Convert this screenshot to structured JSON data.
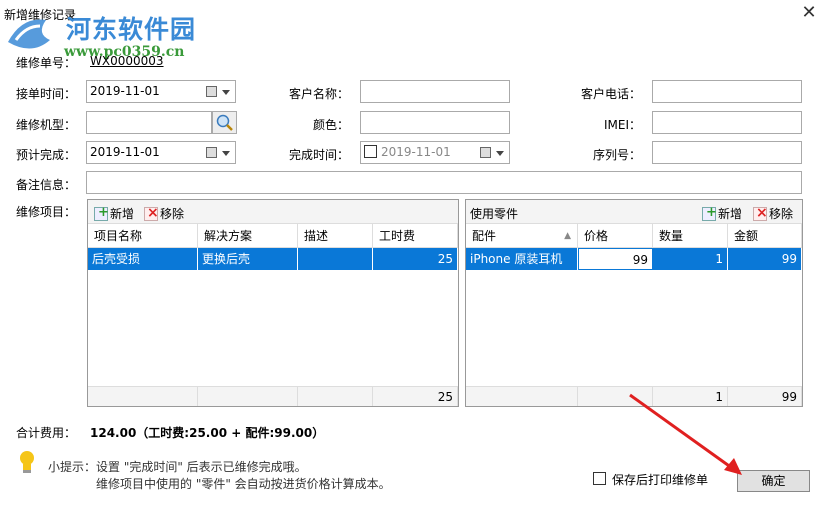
{
  "window": {
    "title": "新增维修记录"
  },
  "watermark": {
    "line1": "河东软件园",
    "line2": "www.pc0359.cn"
  },
  "form": {
    "order_no_label": "维修单号：",
    "order_no": "WX0000003",
    "receive_time_label": "接单时间：",
    "receive_time": "2019-11-01",
    "customer_name_label": "客户名称：",
    "customer_name": "",
    "customer_phone_label": "客户电话：",
    "customer_phone": "",
    "model_label": "维修机型：",
    "model": "",
    "color_label": "颜色：",
    "color": "",
    "imei_label": "IMEI：",
    "imei": "",
    "planned_label": "预计完成：",
    "planned": "2019-11-01",
    "finish_time_label": "完成时间：",
    "finish_time": "2019-11-01",
    "serial_label": "序列号：",
    "serial": "",
    "note_label": "备注信息：",
    "note": "",
    "items_label": "维修项目："
  },
  "items_panel": {
    "add_label": "新增",
    "remove_label": "移除",
    "columns": [
      "项目名称",
      "解决方案",
      "描述",
      "工时费"
    ],
    "rows": [
      {
        "name": "后壳受损",
        "solution": "更换后壳",
        "desc": "",
        "fee": "25"
      }
    ],
    "footer_total": "25"
  },
  "parts_panel": {
    "title": "使用零件",
    "add_label": "新增",
    "remove_label": "移除",
    "columns": [
      "配件",
      "价格",
      "数量",
      "金额"
    ],
    "rows": [
      {
        "part": "iPhone 原装耳机",
        "price": "99",
        "qty": "1",
        "amount": "99"
      }
    ],
    "footer_qty": "1",
    "footer_amount": "99"
  },
  "summary": {
    "label": "合计费用：",
    "value": "124.00（工时费:25.00 + 配件:99.00）"
  },
  "tip": {
    "line1": "小提示：设置 \"完成时间\" 后表示已维修完成哦。",
    "line2": "维修项目中使用的 \"零件\" 会自动按进货价格计算成本。"
  },
  "print_after_save_label": "保存后打印维修单",
  "confirm_label": "确定",
  "colors": {
    "selection": "#0a78d7",
    "arrow": "#e02020"
  }
}
